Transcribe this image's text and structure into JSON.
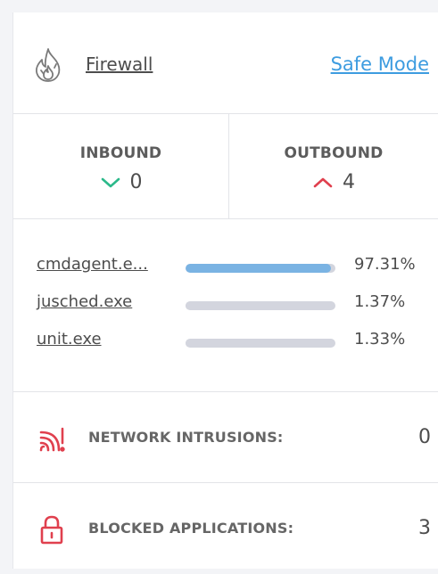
{
  "firewall": {
    "title": "Firewall",
    "mode_link": "Safe Mode",
    "icon": "flame-icon",
    "link_color": "#3d9ce0"
  },
  "traffic": {
    "inbound": {
      "label": "INBOUND",
      "value": "0",
      "icon": "chevron-down-icon",
      "color": "#2bb98a"
    },
    "outbound": {
      "label": "OUTBOUND",
      "value": "4",
      "icon": "chevron-up-icon",
      "color": "#e0404e"
    }
  },
  "apps": [
    {
      "name": "cmdagent.e...",
      "percent_text": "97.31%",
      "percent": 97.31,
      "highlight": true
    },
    {
      "name": "jusched.exe",
      "percent_text": "1.37%",
      "percent": 1.37,
      "highlight": false
    },
    {
      "name": "unit.exe",
      "percent_text": "1.33%",
      "percent": 1.33,
      "highlight": false
    }
  ],
  "stats": {
    "intrusions": {
      "label": "NETWORK INTRUSIONS:",
      "value": "0",
      "icon": "signal-alert-icon",
      "color": "#e0404e"
    },
    "blocked": {
      "label": "BLOCKED APPLICATIONS:",
      "value": "3",
      "icon": "lock-icon",
      "color": "#e0404e"
    }
  }
}
